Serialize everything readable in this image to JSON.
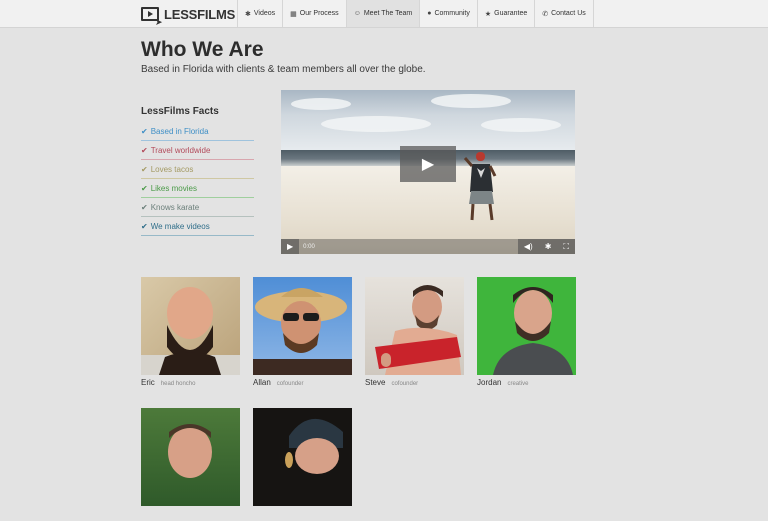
{
  "brand": {
    "name": "LESSFILMS"
  },
  "nav": {
    "items": [
      {
        "label": "Videos",
        "icon": "gear-icon"
      },
      {
        "label": "Our Process",
        "icon": "film-icon"
      },
      {
        "label": "Meet The Team",
        "icon": "smiley-icon",
        "active": true
      },
      {
        "label": "Community",
        "icon": "globe-icon"
      },
      {
        "label": "Guarantee",
        "icon": "star-icon"
      },
      {
        "label": "Contact Us",
        "icon": "phone-icon"
      }
    ]
  },
  "page": {
    "title": "Who We Are",
    "subtitle": "Based in Florida with clients & team members all over the globe."
  },
  "facts": {
    "title": "LessFilms Facts",
    "items": [
      {
        "label": "Based in Florida",
        "color": "#3f8fc6"
      },
      {
        "label": "Travel worldwide",
        "color": "#b24a5a"
      },
      {
        "label": "Loves tacos",
        "color": "#a49a63"
      },
      {
        "label": "Likes movies",
        "color": "#4a9a48"
      },
      {
        "label": "Knows karate",
        "color": "#6b7f7a"
      },
      {
        "label": "We make videos",
        "color": "#2f6e8a"
      }
    ]
  },
  "video": {
    "time": "0:00",
    "controls": [
      "play-icon",
      "volume-icon",
      "settings-icon",
      "fullscreen-icon"
    ]
  },
  "team": [
    {
      "name": "Eric",
      "role": "head honcho"
    },
    {
      "name": "Allan",
      "role": "cofounder"
    },
    {
      "name": "Steve",
      "role": "cofounder"
    },
    {
      "name": "Jordan",
      "role": "creative"
    },
    {
      "name": "",
      "role": ""
    },
    {
      "name": "",
      "role": ""
    }
  ]
}
